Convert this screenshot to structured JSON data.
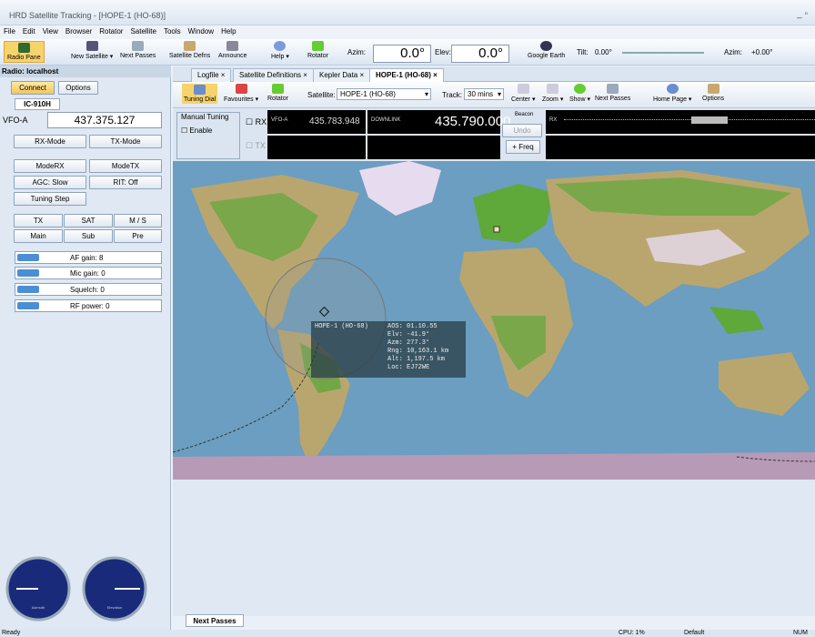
{
  "window": {
    "title": "HRD Satellite Tracking - [HOPE-1 (HO-68)]"
  },
  "menu": [
    "File",
    "Edit",
    "View",
    "Browser",
    "Rotator",
    "Satellite",
    "Tools",
    "Window",
    "Help"
  ],
  "toolbar": {
    "radio_pane": "Radio Pane",
    "new_satellite": "New Satellite ▾",
    "next_passes": "Next Passes",
    "satellite_defns": "Satellite Defns",
    "announce": "Announce",
    "help": "Help ▾",
    "rotator": "Rotator",
    "azim_label": "Azim:",
    "azim_value": "0.0°",
    "elev_label": "Elev:",
    "elev_value": "0.0°",
    "google_earth": "Google Earth",
    "tilt_label": "Tilt:",
    "tilt_value": "0.00°",
    "azim2_label": "Azim:",
    "azim2_value": "+0.00°"
  },
  "left": {
    "header": "Radio: localhost",
    "connect": "Connect",
    "options": "Options",
    "radio_tab": "IC-910H",
    "vfo_label": "VFO-A",
    "vfo_value": "437.375.127",
    "rx_mode": "RX-Mode",
    "tx_mode": "TX-Mode",
    "mode_rx": "ModeRX",
    "mode_tx": "ModeTX",
    "agc": "AGC: Slow",
    "rit": "RIT: Off",
    "tuning_step": "Tuning Step",
    "tx": "TX",
    "sat": "SAT",
    "ms": "M / S",
    "main": "Main",
    "sub": "Sub",
    "pre": "Pre",
    "af_gain": "AF gain: 8",
    "mic_gain": "Mic gain: 0",
    "squelch": "Squelch: 0",
    "rf_power": "RF power: 0",
    "dial1_label": "Azimuth",
    "dial2_label": "Elevation"
  },
  "tabs": [
    "Logfile",
    "Satellite Definitions",
    "Kepler Data",
    "HOPE-1 (HO-68)"
  ],
  "subbar": {
    "tuning_dial": "Tuning Dial",
    "favourites": "Favourites ▾",
    "rotator": "Rotator",
    "satellite_label": "Satellite:",
    "satellite_value": "HOPE-1 (HO-68)",
    "track_label": "Track:",
    "track_value": "30 mins",
    "center": "Center ▾",
    "zoom": "Zoom ▾",
    "show": "Show ▾",
    "next_passes": "Next Passes",
    "home_page": "Home Page ▾",
    "options": "Options"
  },
  "radio": {
    "manual_tuning": "Manual Tuning",
    "enable": "Enable",
    "rx": "RX",
    "tx": "TX",
    "vfoa_label": "VFO-A",
    "vfoa_value": "435.783.948",
    "downlink_label": "DOWNLINK",
    "downlink_value": "435.790.000",
    "beacon": "Beacon",
    "undo": "Undo",
    "freq": "+ Freq",
    "rx_short": "RX"
  },
  "popup": {
    "name": "HOPE-1 (HO-68)",
    "aos": "AOS: 01.10.55",
    "elv": "Elv: -41.9°",
    "azm": "Azm: 277.3°",
    "rng": "Rng: 10,163.1 km",
    "alt": "Alt: 1,197.5 km",
    "loc": "Loc: EJ72WE"
  },
  "bottom_tab": "Next Passes",
  "status": {
    "left": "Ready",
    "cpu": "CPU: 1%",
    "default": "Default",
    "num": "NUM"
  },
  "colors": {
    "ocean": "#6b9ec0",
    "land": "#b9a66f",
    "veg": "#5fa83a",
    "ice": "#e7dcef"
  }
}
